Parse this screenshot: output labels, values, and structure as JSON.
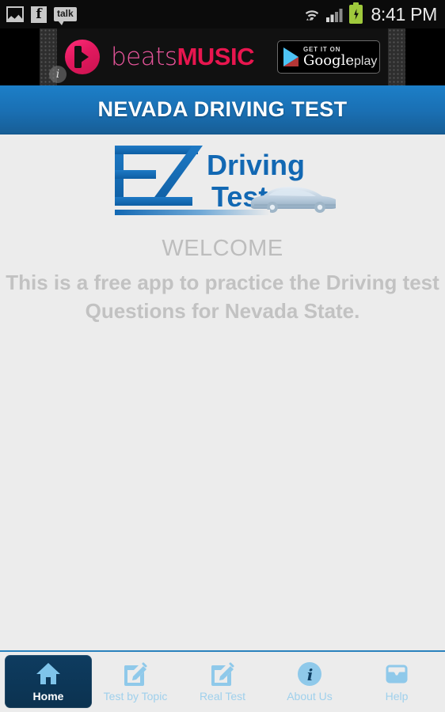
{
  "status_bar": {
    "time": "8:41 PM",
    "left_icons": [
      {
        "name": "photo-icon",
        "label": "Gallery"
      },
      {
        "name": "facebook-icon",
        "label": "f"
      },
      {
        "name": "talk-icon",
        "label": "talk"
      }
    ],
    "right_icons": [
      {
        "name": "wifi-icon",
        "label": "WiFi"
      },
      {
        "name": "cell-signal-icon",
        "label": "Signal"
      },
      {
        "name": "battery-charging-icon",
        "label": "Battery charging"
      }
    ]
  },
  "ad": {
    "brand_light": "beats",
    "brand_bold": "MUSIC",
    "badge_top": "GET IT ON",
    "badge_main": "Google",
    "badge_main_suffix": "play",
    "info_label": "i"
  },
  "header": {
    "title": "NEVADA DRIVING TEST"
  },
  "logo": {
    "mark": "EZ",
    "line1": "Driving",
    "line2": "Test"
  },
  "main": {
    "welcome": "WELCOME",
    "description": "This is a free app to practice the Driving test Questions for Nevada State."
  },
  "tabbar": {
    "items": [
      {
        "label": "Home",
        "icon": "home-icon",
        "selected": true
      },
      {
        "label": "Test by Topic",
        "icon": "edit-square-icon",
        "selected": false
      },
      {
        "label": "Real Test",
        "icon": "edit-square-icon",
        "selected": false
      },
      {
        "label": "About Us",
        "icon": "info-circle-icon",
        "selected": false
      },
      {
        "label": "Help",
        "icon": "inbox-tray-icon",
        "selected": false
      }
    ]
  },
  "colors": {
    "header_blue": "#1a70b4",
    "tab_blue": "#1b6496",
    "icon_blue": "#8fc9ea",
    "logo_blue": "#1268b3",
    "body_bg": "#ececec",
    "muted_text": "#c0c0c0"
  }
}
